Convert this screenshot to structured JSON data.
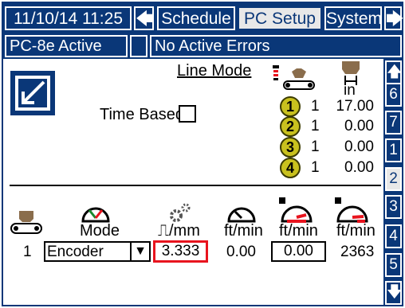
{
  "top": {
    "datetime": "11/10/14 11:25",
    "left_arrow": "🡄",
    "tab_schedule": "Schedule",
    "tab_pcsetup": "PC Setup",
    "tab_system": "System",
    "right_arrow": "🡆"
  },
  "status": {
    "active": "PC-8e Active",
    "errors": "No Active Errors"
  },
  "side_keys": [
    "🡅",
    "6",
    "7",
    "1",
    "2",
    "3",
    "4",
    "5",
    "🡇"
  ],
  "section1": {
    "line_mode_label": "Line Mode",
    "time_based_label": "Time Based",
    "unit_in": "in",
    "rows": [
      {
        "num": "1",
        "count": "1",
        "value": "17.00"
      },
      {
        "num": "2",
        "count": "1",
        "value": "0.00"
      },
      {
        "num": "3",
        "count": "1",
        "value": "0.00"
      },
      {
        "num": "4",
        "count": "1",
        "value": "0.00"
      }
    ]
  },
  "section2": {
    "mode_label": "Mode",
    "pulse_label": "⎍/mm",
    "ftmin1": "ft/min",
    "ftmin2": "ft/min",
    "ftmin3": "ft/min",
    "row_num": "1",
    "mode_value": "Encoder",
    "dropdown_arrow": "▼",
    "pulse_value": "3.333",
    "speed_value": "0.00",
    "speed_input": "0.00",
    "speed_max": "2363"
  },
  "colors": {
    "header_blue": "#0a3778",
    "highlight_red": "#e8141e",
    "circle_yellow": "#c9c11e"
  }
}
